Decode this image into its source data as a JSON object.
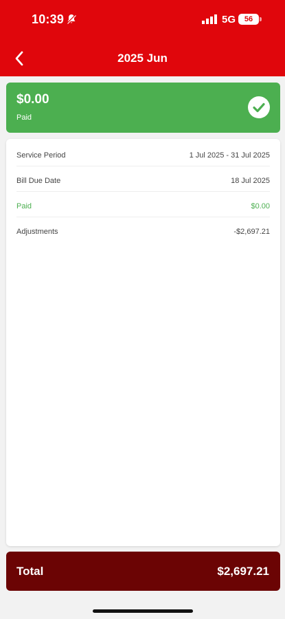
{
  "status_bar": {
    "time": "10:39",
    "network": "5G",
    "battery": "56"
  },
  "header": {
    "title": "2025 Jun"
  },
  "status_card": {
    "amount": "$0.00",
    "status": "Paid"
  },
  "details": [
    {
      "label": "Service Period",
      "value": "1 Jul 2025 - 31 Jul 2025"
    },
    {
      "label": "Bill Due Date",
      "value": "18 Jul 2025"
    },
    {
      "label": "Paid",
      "value": "$0.00"
    },
    {
      "label": "Adjustments",
      "value": "-$2,697.21"
    }
  ],
  "total": {
    "label": "Total",
    "value": "$2,697.21"
  },
  "colors": {
    "header": "#e0060c",
    "paid_green": "#4caf50",
    "total_bar": "#6b0404"
  }
}
